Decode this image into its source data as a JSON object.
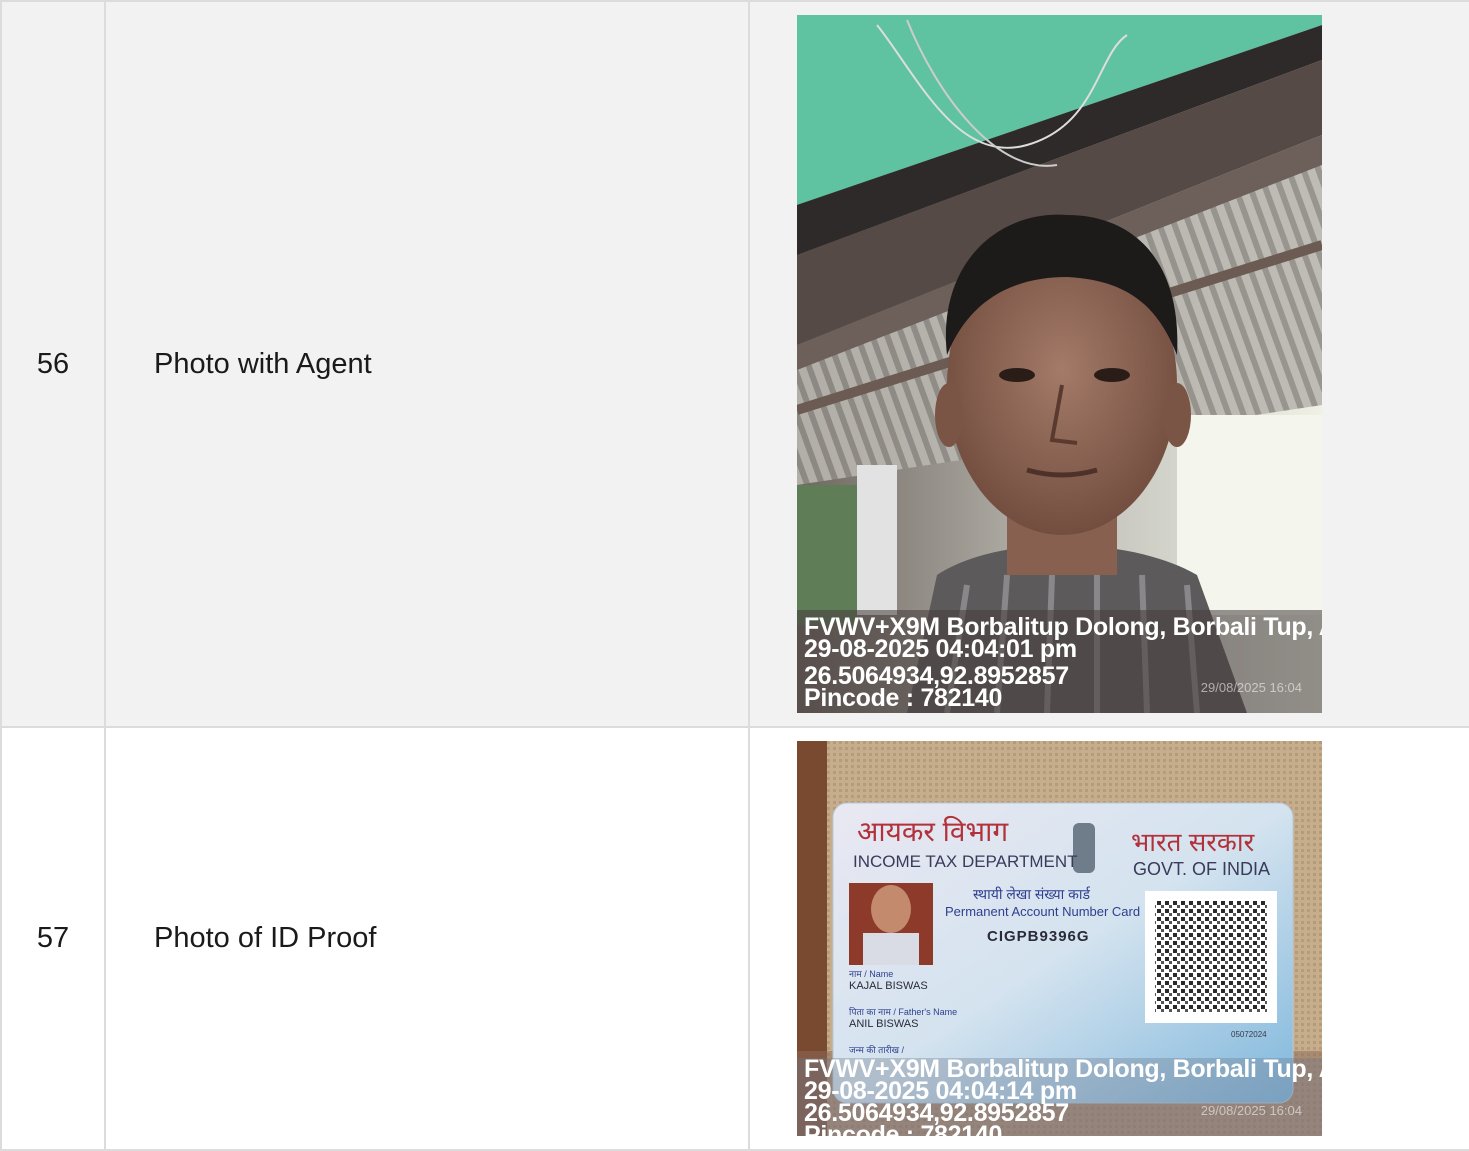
{
  "rows": [
    {
      "number": "56",
      "label": "Photo with Agent",
      "stamp": {
        "address": "FVWV+X9M Borbalitup Dolong, Borbali Tup, A",
        "datetime": "29-08-2025 04:04:01 pm",
        "coordinates": "26.5064934,92.8952857",
        "pincode": "Pincode : 782140",
        "camera_time": "29/08/2025 16:04"
      }
    },
    {
      "number": "57",
      "label": "Photo of ID Proof",
      "card": {
        "dept_hindi": "आयकर विभाग",
        "dept_english": "INCOME TAX DEPARTMENT",
        "govt_hindi": "भारत सरकार",
        "govt_english": "GOVT. OF INDIA",
        "card_title_hindi": "स्थायी लेखा संख्या कार्ड",
        "card_title_english": "Permanent Account Number Card",
        "pan_number": "CIGPB9396G",
        "name_caption": "नाम / Name",
        "name_value": "KAJAL BISWAS",
        "father_caption": "पिता का नाम / Father's Name",
        "father_value": "ANIL BISWAS",
        "dob_caption": "जन्म की तारीख /",
        "issue_code": "05072024"
      },
      "stamp": {
        "address": "FVWV+X9M Borbalitup Dolong, Borbali Tup, A",
        "datetime": "29-08-2025 04:04:14 pm",
        "coordinates": "26.5064934,92.8952857",
        "pincode": "Pincode : 782140",
        "camera_time": "29/08/2025 16:04"
      }
    }
  ]
}
